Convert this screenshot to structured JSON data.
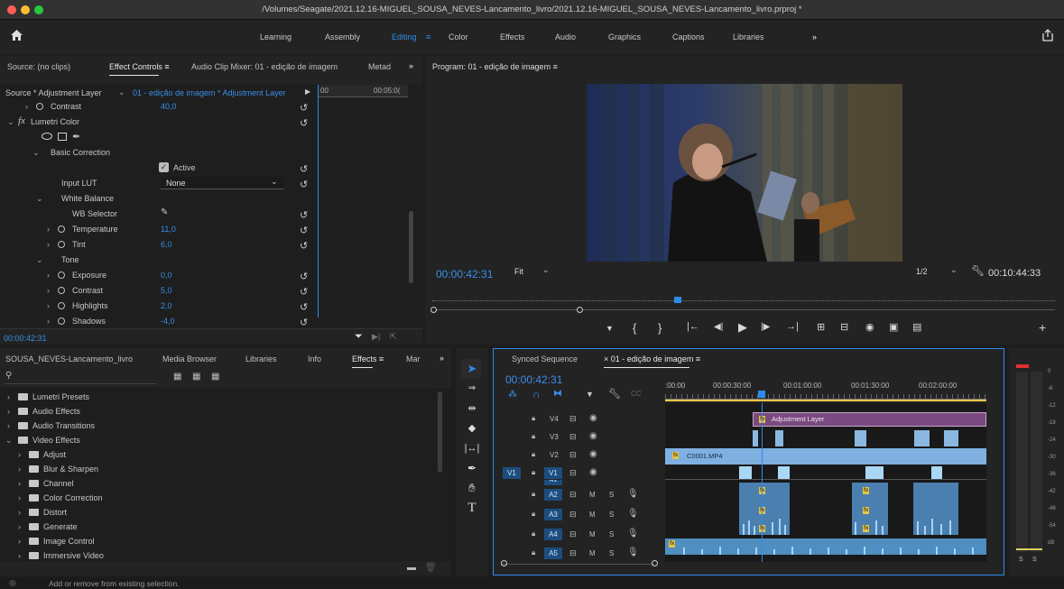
{
  "window": {
    "title": "/Volumes/Seagate/2021.12.16-MIGUEL_SOUSA_NEVES-Lancamento_livro/2021.12.16-MIGUEL_SOUSA_NEVES-Lancamento_livro.prproj *"
  },
  "workspaces": [
    "Learning",
    "Assembly",
    "Editing",
    "Color",
    "Effects",
    "Audio",
    "Graphics",
    "Captions",
    "Libraries"
  ],
  "workspace_active": "Editing",
  "colors": {
    "accent": "#2d8ceb",
    "adjustment_clip": "#7a4a80",
    "video_clip": "#8ab8e0",
    "audio_clip": "#4a7fb0",
    "fx_badge": "#e2c44a"
  },
  "effect_controls": {
    "tabs": [
      "Source: (no clips)",
      "Effect Controls",
      "Audio Clip Mixer: 01 - edição de imagem",
      "Metad"
    ],
    "source_label": "Source * Adjustment Layer",
    "sequence_label": "01 - edição de imagem * Adjustment Layer",
    "ruler": [
      "00",
      "00:05:0("
    ],
    "rows": [
      {
        "label": "Contrast",
        "value": "40,0"
      },
      {
        "label": "Lumetri Color",
        "value": ""
      },
      {
        "label": "Basic Correction",
        "value": ""
      },
      {
        "label": "Active",
        "value": ""
      },
      {
        "label": "Input LUT",
        "value": "None"
      },
      {
        "label": "White Balance",
        "value": ""
      },
      {
        "label": "WB Selector",
        "value": ""
      },
      {
        "label": "Temperature",
        "value": "11,0"
      },
      {
        "label": "Tint",
        "value": "6,0"
      },
      {
        "label": "Tone",
        "value": ""
      },
      {
        "label": "Exposure",
        "value": "0,0"
      },
      {
        "label": "Contrast",
        "value": "5,0"
      },
      {
        "label": "Highlights",
        "value": "2,0"
      },
      {
        "label": "Shadows",
        "value": "-4,0"
      }
    ],
    "timecode": "00:00:42:31"
  },
  "program": {
    "title": "Program: 01 - edição de imagem",
    "timecode": "00:00:42:31",
    "fit": "Fit",
    "resolution": "1/2",
    "duration": "00:10:44:33"
  },
  "project": {
    "tabs": [
      "SOUSA_NEVES-Lancamento_livro",
      "Media Browser",
      "Libraries",
      "Info",
      "Effects",
      "Mar"
    ],
    "items": [
      "Lumetri Presets",
      "Audio Effects",
      "Audio Transitions",
      "Video Effects",
      "Adjust",
      "Blur & Sharpen",
      "Channel",
      "Color Correction",
      "Distort",
      "Generate",
      "Image Control",
      "Immersive Video"
    ]
  },
  "timeline": {
    "tabs": [
      "Synced Sequence",
      "01 - edição de imagem"
    ],
    "timecode": "00:00:42:31",
    "ruler": [
      ":00:00",
      "00:00:30:00",
      "00:01:00:00",
      "00:01:30:00",
      "00:02:00:00"
    ],
    "tracks": [
      "V4",
      "V3",
      "V2",
      "V1",
      "A1",
      "A2",
      "A3",
      "A4",
      "A5"
    ],
    "source_patch": "V1",
    "clip_adjustment": "Adjustment Layer",
    "clip_video": "C0001.MP4",
    "fx": "fx",
    "m": "M",
    "s": "S"
  },
  "meter": {
    "ticks": [
      "0",
      "-6",
      "-12",
      "-18",
      "-24",
      "-30",
      "-36",
      "-42",
      "-48",
      "-54",
      "dB"
    ],
    "solo": [
      "S",
      "S"
    ]
  },
  "status": {
    "text": "Add or remove from existing selection."
  }
}
